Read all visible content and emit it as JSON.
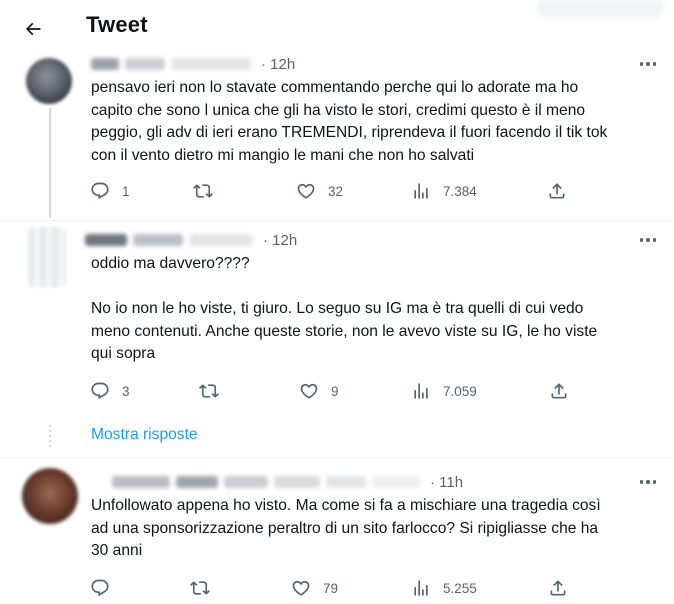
{
  "header": {
    "title": "Tweet",
    "back_icon": "arrow-left-icon"
  },
  "tweets": [
    {
      "time": "· 12h",
      "text": "pensavo ieri non lo stavate commentando perche qui lo adorate ma ho\ncapito che sono l unica che gli ha visto le stori, credimi questo è il meno\npeggio, gli adv di ieri erano TREMENDI, riprendeva il fuori facendo il tik tok\ncon il vento dietro mi mangio le mani che non  ho salvati",
      "replies": "1",
      "retweets": "",
      "likes": "32",
      "views": "7.384"
    },
    {
      "time": "· 12h",
      "text": "oddio ma davvero????\n\nNo io non le ho viste, ti giuro. Lo seguo su IG ma è tra quelli di cui vedo\nmeno contenuti. Anche queste storie, non le avevo viste su IG, le ho viste\nqui sopra",
      "replies": "3",
      "retweets": "",
      "likes": "9",
      "views": "7.059"
    },
    {
      "time": "· 11h",
      "text": "Unfollowato appena ho visto. Ma come si fa a mischiare una tragedia così\nad una sponsorizzazione peraltro di un sito farlocco? Si ripigliasse che ha\n30 anni",
      "replies": "",
      "retweets": "",
      "likes": "79",
      "views": "5.255"
    }
  ],
  "show_replies": "Mostra risposte",
  "colors": {
    "accent": "#1d9bf0",
    "text": "#0f1419",
    "muted": "#536471",
    "border": "#eff3f4"
  }
}
